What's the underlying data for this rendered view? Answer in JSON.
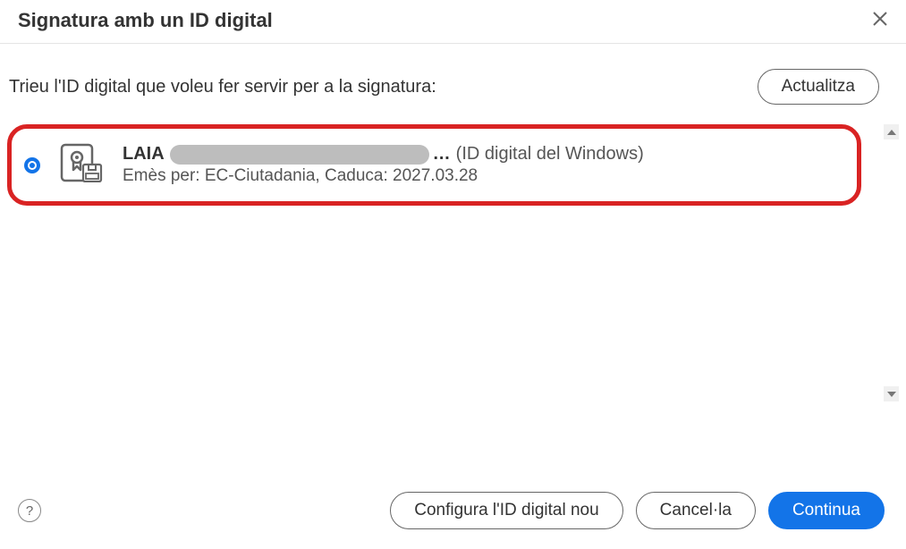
{
  "dialog": {
    "title": "Signatura amb un ID digital",
    "instruction": "Trieu l'ID digital que voleu fer servir per a la signatura:",
    "update_btn": "Actualitza"
  },
  "certificate": {
    "name": "LAIA",
    "ellipsis": "…",
    "source": "(ID digital del Windows)",
    "details": "Emès per: EC-Ciutadania, Caduca: 2027.03.28"
  },
  "footer": {
    "help": "?",
    "configure": "Configura l'ID digital nou",
    "cancel": "Cancel·la",
    "continue": "Continua"
  }
}
